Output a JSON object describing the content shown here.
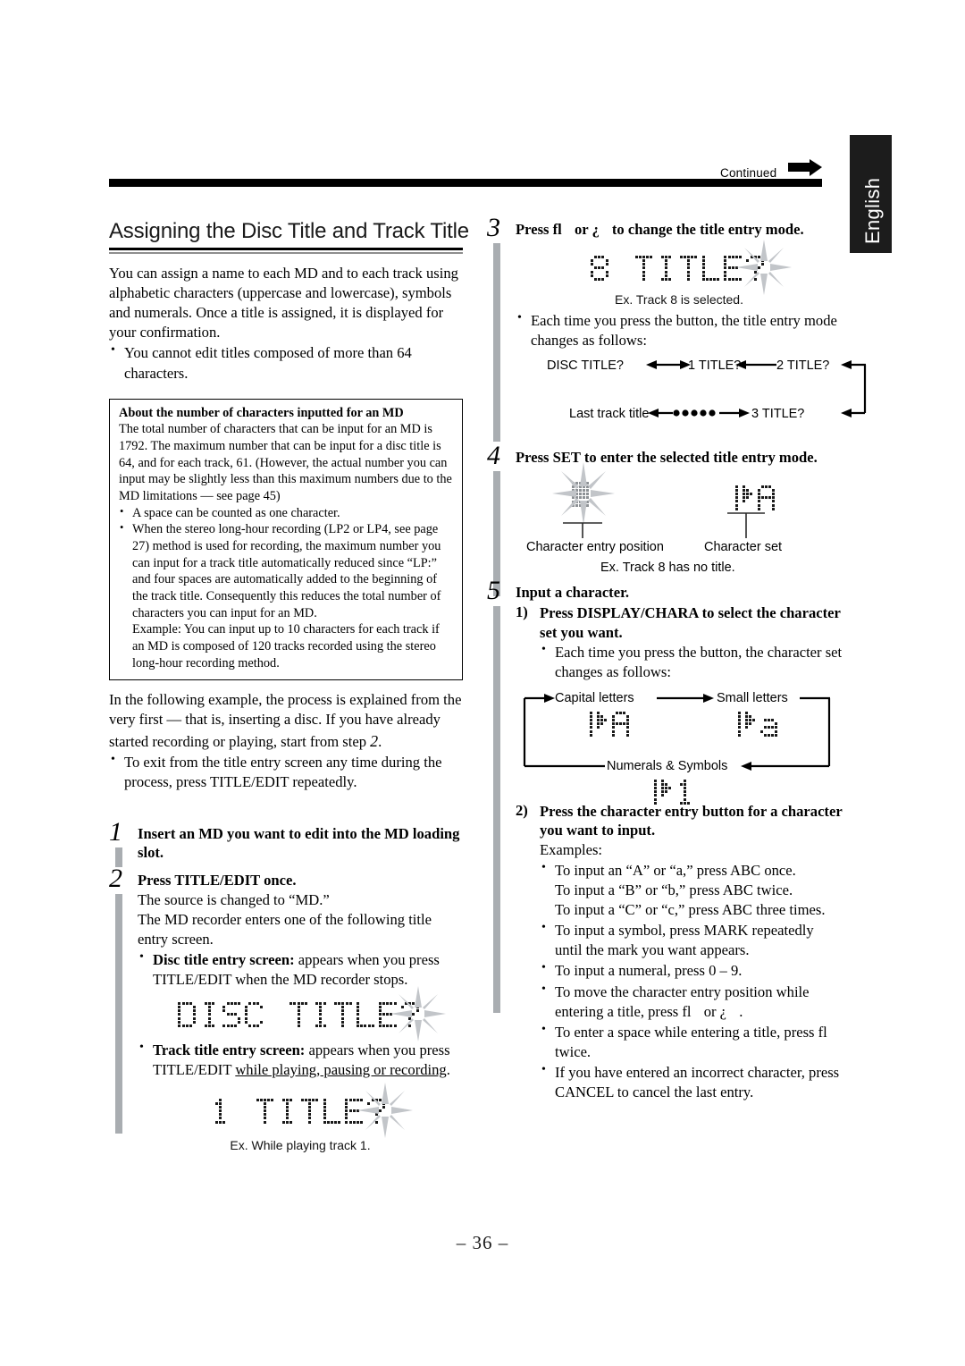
{
  "header": {
    "continued_label": "Continued",
    "continued_icon": "right-arrow-icon",
    "language_tab": "English"
  },
  "footer": {
    "page_number": "– 36 –"
  },
  "left_column": {
    "section_title": "Assigning the Disc Title and Track Title",
    "intro_paragraph": "You can assign a name to each MD and to each track using alphabetic characters (uppercase and lowercase), symbols and numerals. Once a title is assigned, it is displayed for your confirmation.",
    "intro_bullet": "You cannot edit titles composed of more than 64 characters.",
    "info_box": {
      "heading": "About the number of characters inputted for an MD",
      "paragraph": "The total number of characters that can be input for an MD is 1792. The maximum number that can be input for a disc title is 64, and for each track, 61. (However, the actual number you can input may be slightly less than this maximum numbers due to the MD limitations — see page 45)",
      "bullet1": "A space can be counted as one character.",
      "bullet2": "When the stereo long-hour recording (LP2 or LP4, see page 27) method is used for recording, the maximum number you can input for a track title automatically reduced since “LP:” and four spaces are automatically added to the beginning of the track title. Consequently this reduces the total number of characters you can input for an MD.",
      "bullet2_example": "Example: You can input up to 10 characters for each track if an MD is composed of 120 tracks recorded using the stereo long-hour recording method."
    },
    "after_box_paragraph_part1": "In the following example, the process is explained from the very first — that is, inserting a disc. If you have already started recording or playing, start from step ",
    "after_box_paragraph_step": "2",
    "after_box_paragraph_part2": ".",
    "after_box_bullet": "To exit from the title entry screen any time during the process, press TITLE/EDIT repeatedly.",
    "step1": {
      "number": "1",
      "heading": "Insert an MD you want to edit into the MD loading slot."
    },
    "step2": {
      "number": "2",
      "heading": "Press TITLE/EDIT once.",
      "line1": "The source is changed to “MD.”",
      "line2": "The MD recorder enters one of the following title entry screen.",
      "bullet1_bold": "Disc title entry screen:",
      "bullet1_rest": " appears when you press TITLE/EDIT when the MD recorder stops.",
      "display1": "DISC TITLE?",
      "bullet2_bold": "Track title entry screen:",
      "bullet2_rest_plain": " appears when you press TITLE/EDIT ",
      "bullet2_rest_underline": "while playing, pausing or recording",
      "bullet2_rest_end": ".",
      "display2": "1 TITLE?",
      "caption2": "Ex. While playing track 1."
    }
  },
  "right_column": {
    "step3": {
      "number": "3",
      "heading_part1": "Press ",
      "heading_key1": "fl",
      "heading_part2": " or ",
      "heading_key2": "¿",
      "heading_part3": " to change the title entry mode.",
      "display": "8 TITLE?",
      "caption": "Ex. Track 8 is selected.",
      "bullet": "Each time you press the button, the title entry mode changes as follows:",
      "flow": {
        "node1": "DISC TITLE?",
        "node2": "1 TITLE?",
        "node3": "2 TITLE?",
        "node4": "3 TITLE?",
        "node5": "●●●●●●",
        "node6": "Last track title"
      }
    },
    "step4": {
      "number": "4",
      "heading": "Press SET to enter the selected title entry mode.",
      "label_left": "Character entry position",
      "label_right": "Character set",
      "char_set_display": "⊣A",
      "caption": "Ex. Track 8 has no title."
    },
    "step5": {
      "number": "5",
      "heading": "Input a character.",
      "sub1_number": "1)",
      "sub1_heading": "Press DISPLAY/CHARA to select the character set you want.",
      "sub1_bullet": "Each time you press the button, the character set changes as follows:",
      "cycle": {
        "capital_label": "Capital letters",
        "capital_display": "⊣A",
        "small_label": "Small letters",
        "small_display": "⊣a",
        "numerals_label": "Numerals & Symbols",
        "numerals_display": "⊣1"
      },
      "sub2_number": "2)",
      "sub2_heading": "Press the character entry button for a character you want to input.",
      "examples_label": "Examples:",
      "ex1_line1": "To input an “A” or “a,” press ABC once.",
      "ex1_line2": "To input a “B” or “b,” press ABC twice.",
      "ex1_line3": "To input a “C” or “c,” press ABC three times.",
      "ex2": "To input a symbol, press MARK repeatedly until the mark you want appears.",
      "ex3": "To input a numeral, press 0 – 9.",
      "ex4_part1": "To move the character entry position while entering a title, press ",
      "ex4_key1": "fl",
      "ex4_part2": " or ",
      "ex4_key2": "¿",
      "ex4_part3": " .",
      "ex5_part1": "To enter a space while entering a title, press ",
      "ex5_key": "fl",
      "ex5_part2": " twice.",
      "ex6": "If you have entered an incorrect character, press CANCEL to cancel the last entry."
    }
  },
  "colors": {
    "step_bar": "#a9adb1",
    "rule_dark": "#000000",
    "rule_gray": "#8e8e8e",
    "tab_bg": "#1c1c1c",
    "burst": "#b9bcc0"
  }
}
